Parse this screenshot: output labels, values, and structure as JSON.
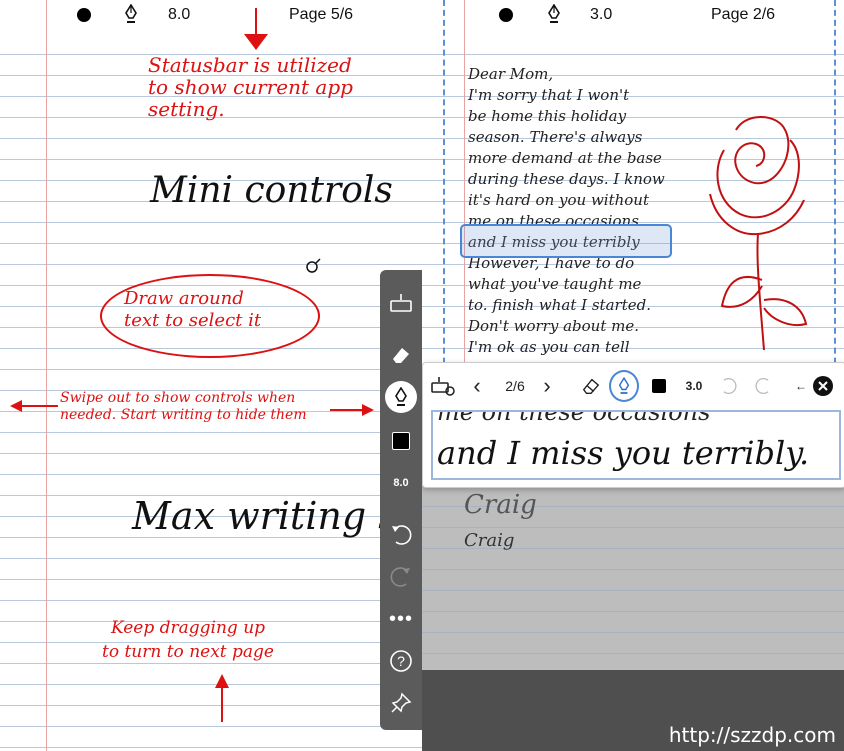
{
  "left": {
    "status": {
      "pen_size": "8.0",
      "page": "Page 5/6"
    },
    "annotations": {
      "statusbar_note": [
        "Statusbar is utilized",
        "to show current app",
        "setting."
      ],
      "mini_controls": "Mini controls",
      "lasso_note": [
        "Draw around",
        "text to select it"
      ],
      "swipe_note": [
        "Swipe out to show controls when",
        "needed. Start writing to hide them"
      ],
      "max_space": "Max writing space",
      "drag_note": [
        "Keep dragging up",
        "to turn to next page"
      ]
    },
    "toolbar": {
      "size_label": "8.0"
    }
  },
  "right": {
    "status": {
      "pen_size": "3.0",
      "page": "Page 2/6"
    },
    "letter_lines": [
      "Dear Mom,",
      "I'm sorry that I won't",
      "be home this holiday",
      "season. There's always",
      "more demand at the base",
      "during these days. I know",
      "it's hard on you without",
      "me on these occasions",
      "and I miss you terribly",
      "However, I have to do",
      "what you've taught me",
      "to. finish what I started.",
      "Don't worry about me.",
      "I'm ok as you can tell"
    ],
    "toolbar": {
      "page_label": "2/6",
      "size_label": "3.0"
    },
    "write_lines": [
      "me on these occasions",
      "and I miss you terribly."
    ],
    "signature": [
      "Craig",
      "Craig"
    ],
    "watermark": "http://szzdp.com"
  }
}
